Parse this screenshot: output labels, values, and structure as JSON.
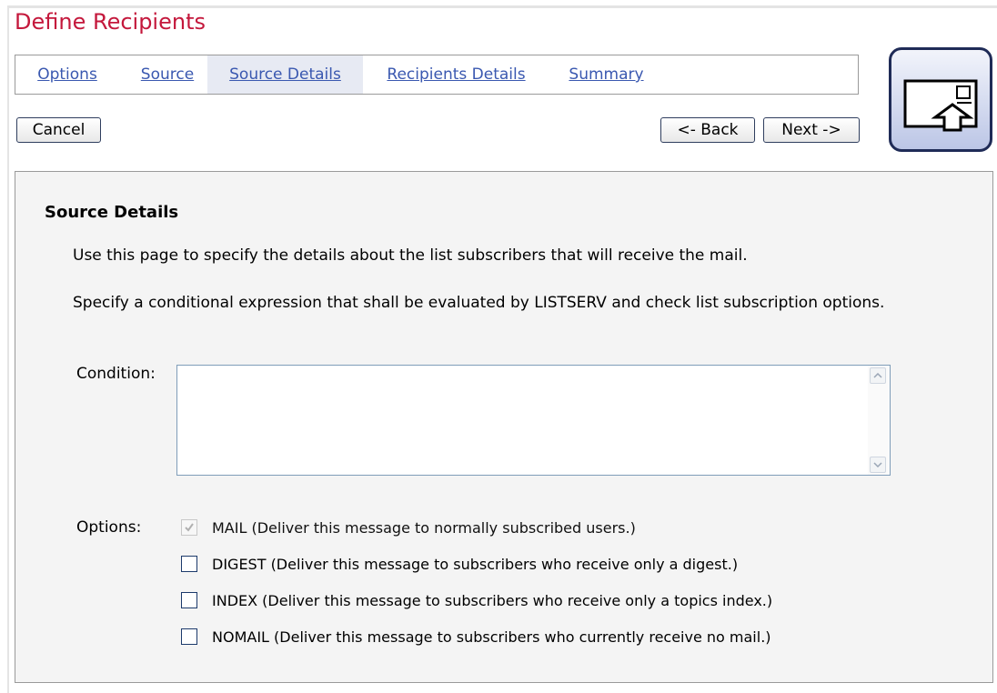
{
  "page": {
    "title": "Define Recipients"
  },
  "tabs": [
    {
      "label": "Options",
      "active": false
    },
    {
      "label": "Source",
      "active": false
    },
    {
      "label": "Source Details",
      "active": true
    },
    {
      "label": "Recipients Details",
      "active": false
    },
    {
      "label": "Summary",
      "active": false
    }
  ],
  "buttons": {
    "cancel": "Cancel",
    "back": "<- Back",
    "next": "Next ->"
  },
  "icon": {
    "name": "send-mail-icon"
  },
  "section": {
    "title": "Source Details",
    "description_1": "Use this page to specify the details about the list subscribers that will receive the mail.",
    "description_2": "Specify a conditional expression that shall be evaluated by LISTSERV and check list subscription options."
  },
  "condition": {
    "label": "Condition:",
    "value": ""
  },
  "options": {
    "label": "Options:",
    "items": [
      {
        "label": "MAIL (Deliver this message to normally subscribed users.)",
        "checked": true,
        "disabled": true
      },
      {
        "label": "DIGEST (Deliver this message to subscribers who receive only a digest.)",
        "checked": false,
        "disabled": false
      },
      {
        "label": "INDEX (Deliver this message to subscribers who receive only a topics index.)",
        "checked": false,
        "disabled": false
      },
      {
        "label": "NOMAIL (Deliver this message to subscribers who currently receive no mail.)",
        "checked": false,
        "disabled": false
      }
    ]
  },
  "colors": {
    "title": "#c4183c",
    "link": "#3a58b0",
    "active_tab_bg": "#e7eaf3",
    "panel_bg": "#f4f4f4"
  }
}
